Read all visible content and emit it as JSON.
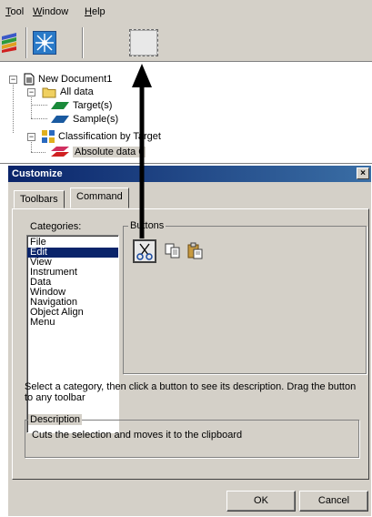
{
  "menubar": {
    "items": [
      {
        "accel": "T",
        "rest": "ool"
      },
      {
        "accel": "W",
        "rest": "indow"
      },
      {
        "accel": "H",
        "rest": "elp"
      }
    ]
  },
  "tree": {
    "root": "New Document1",
    "all_data": "All data",
    "target": "Target(s)",
    "sample": "Sample(s)",
    "classification": "Classification by Target",
    "absolute": "Absolute data 0"
  },
  "dialog": {
    "title": "Customize",
    "close": "×",
    "tabs": [
      "Toolbars",
      "Command"
    ],
    "categories_label": "Categories:",
    "categories": [
      "File",
      "Edit",
      "View",
      "Instrument",
      "Data",
      "Window",
      "Navigation",
      "Object Align",
      "Menu"
    ],
    "selected_category": "Edit",
    "buttons_label": "Buttons",
    "instruction": "Select a category, then click a button to see its description. Drag the button to any toolbar",
    "description_label": "Description",
    "description": "Cuts the selection and moves it to the clipboard",
    "ok": "OK",
    "cancel": "Cancel"
  },
  "colors": {
    "face": "#d4d0c8",
    "title_start": "#0a246a",
    "title_end": "#3a6ea5",
    "selection": "#0a246a"
  }
}
